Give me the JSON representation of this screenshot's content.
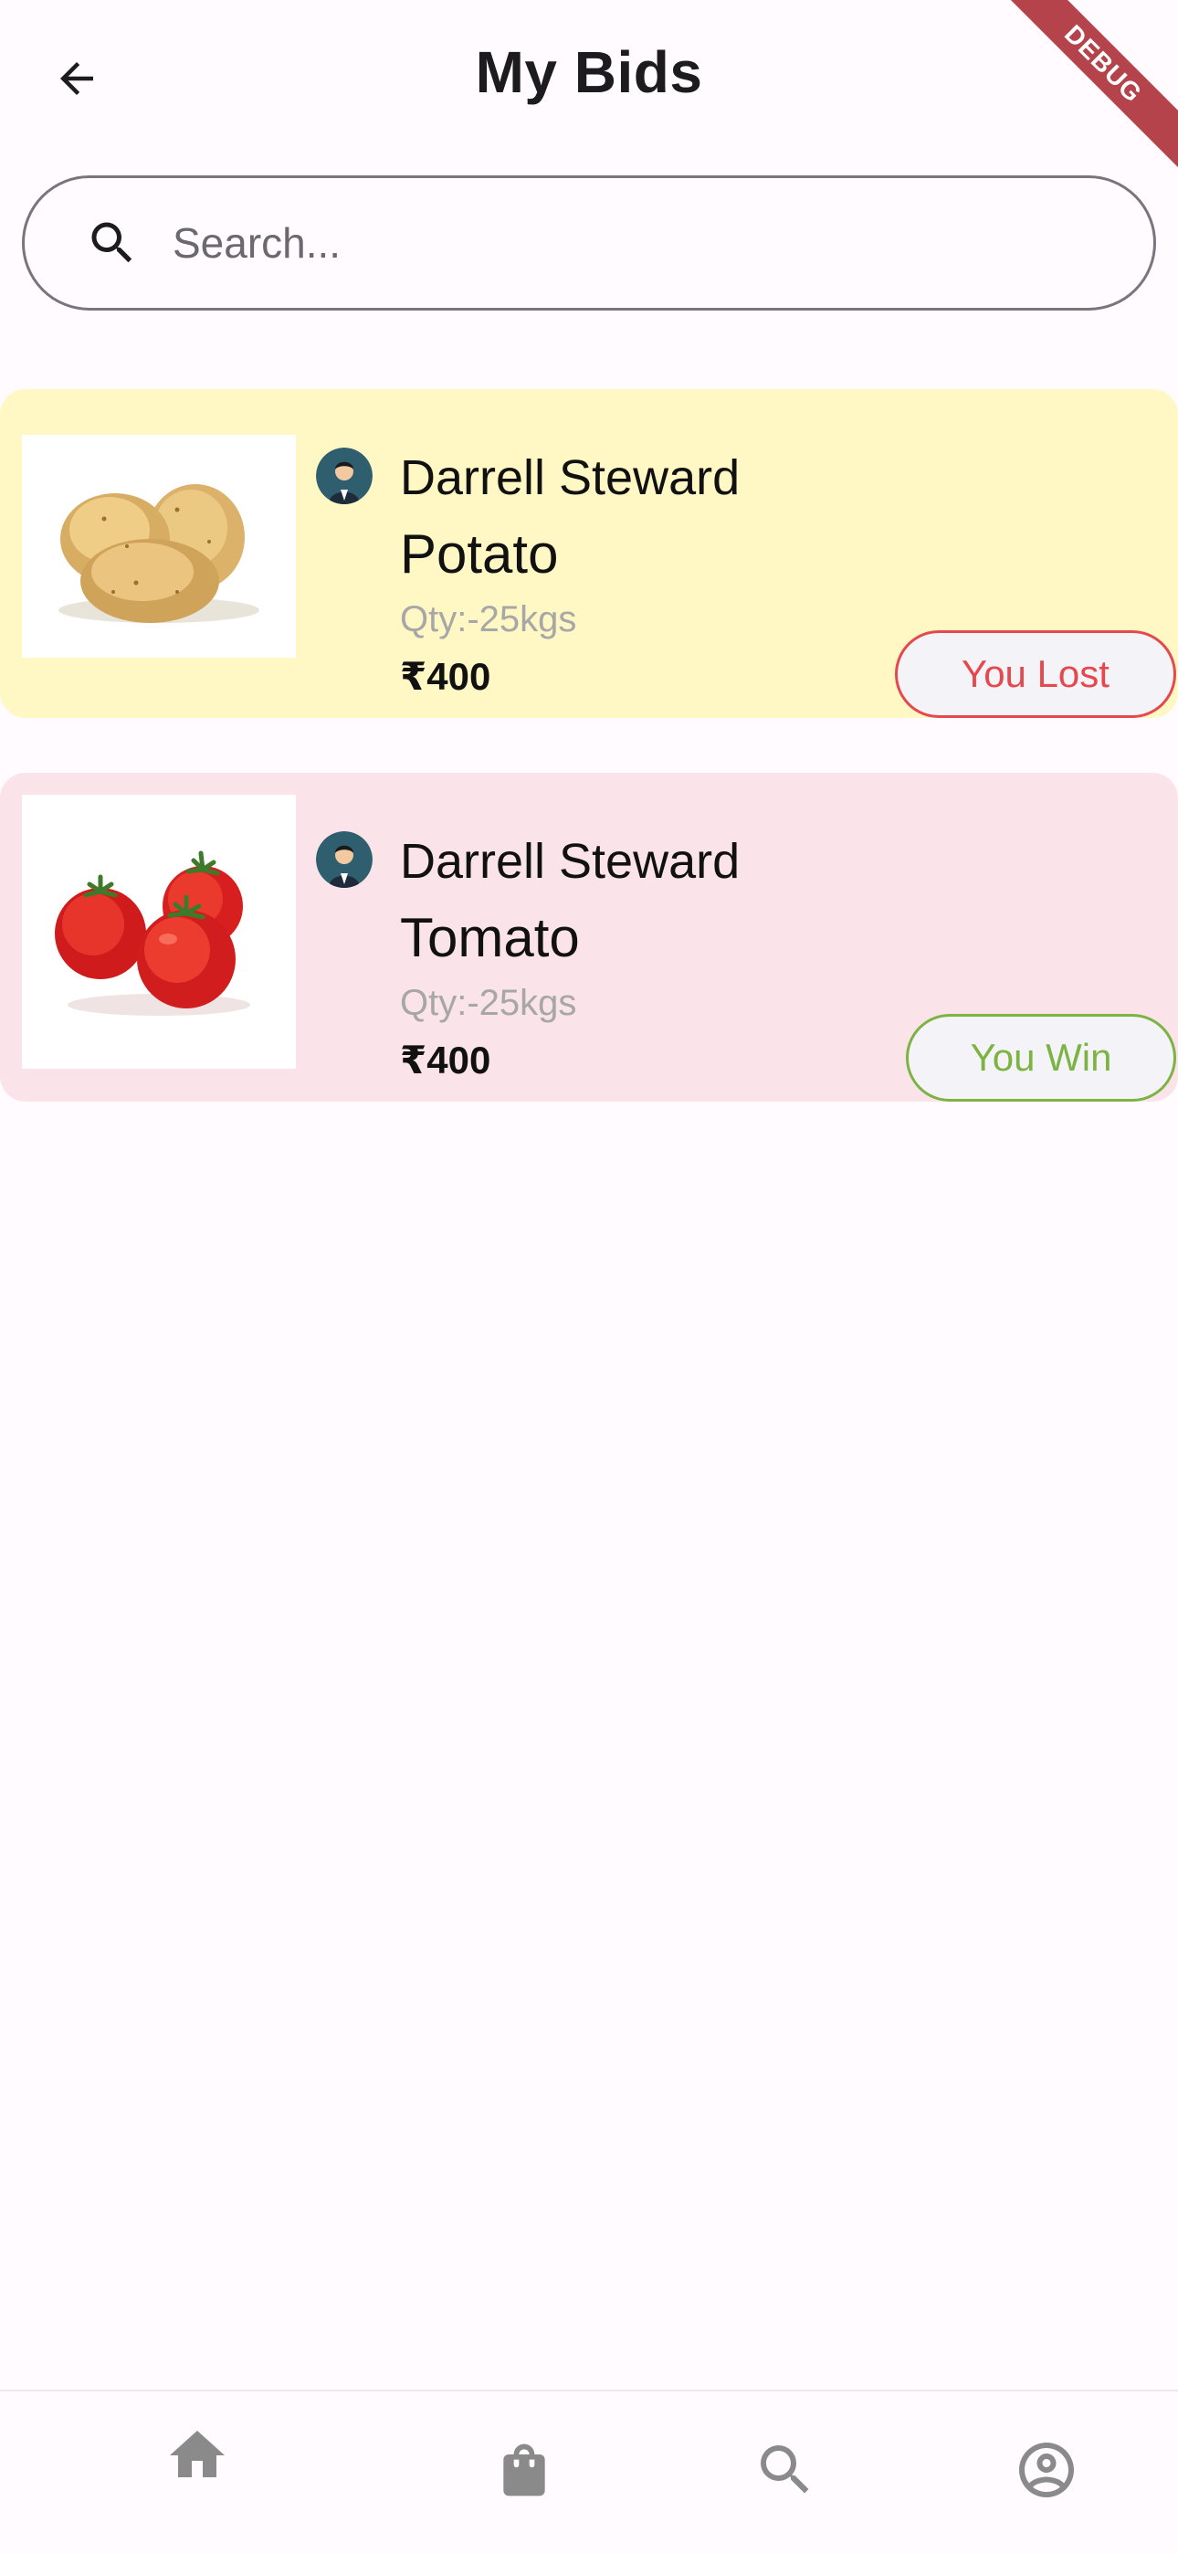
{
  "header": {
    "title": "My Bids",
    "debug_banner": "DEBUG"
  },
  "search": {
    "placeholder": "Search...",
    "value": ""
  },
  "bids": [
    {
      "seller": "Darrell Steward",
      "product": "Potato",
      "qty": "Qty:-25kgs",
      "price": "₹400",
      "status": "You Lost",
      "status_color": "#e5484d",
      "card_color": "#fff8c4",
      "image": "potato-image"
    },
    {
      "seller": "Darrell Steward",
      "product": "Tomato",
      "qty": "Qty:-25kgs",
      "price": "₹400",
      "status": "You Win",
      "status_color": "#7cb342",
      "card_color": "#fae4ea",
      "image": "tomato-image"
    }
  ],
  "bottom_nav": {
    "items": [
      {
        "icon": "home-icon",
        "active": true
      },
      {
        "icon": "shopping-bag-icon",
        "active": false
      },
      {
        "icon": "search-icon",
        "active": false
      },
      {
        "icon": "account-circle-icon",
        "active": false
      }
    ]
  }
}
